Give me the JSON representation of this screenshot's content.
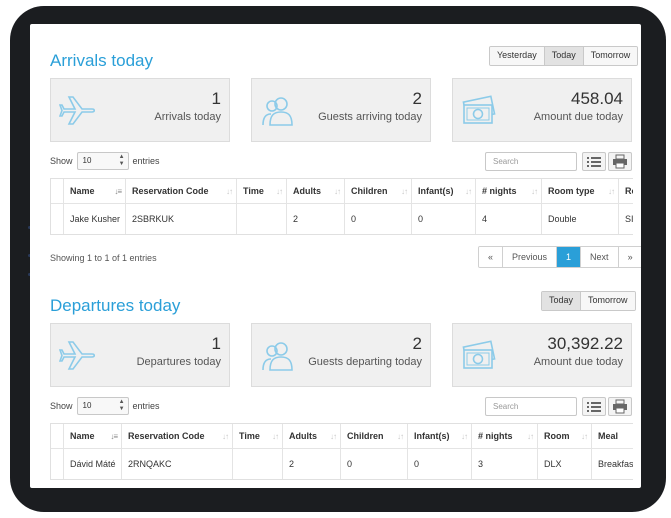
{
  "arrivals": {
    "title": "Arrivals today",
    "day_buttons": [
      "Yesterday",
      "Today",
      "Tomorrow"
    ],
    "stats": [
      {
        "value": "1",
        "label": "Arrivals today",
        "icon": "airplane-icon"
      },
      {
        "value": "2",
        "label": "Guests arriving today",
        "icon": "guests-icon"
      },
      {
        "value": "458.04",
        "label": "Amount due today",
        "icon": "money-icon"
      }
    ],
    "show_label": "Show",
    "entries_value": "10",
    "entries_label": "entries",
    "search_placeholder": "Search",
    "columns": [
      "Name",
      "Reservation Code",
      "Time",
      "Adults",
      "Children",
      "Infant(s)",
      "# nights",
      "Room type",
      "Ro"
    ],
    "rows": [
      [
        "Jake Kusher",
        "2SBRKUK",
        "",
        "2",
        "0",
        "0",
        "4",
        "Double",
        "SI"
      ]
    ],
    "info": "Showing 1 to 1 of 1 entries",
    "pager": [
      "«",
      "Previous",
      "1",
      "Next",
      "»"
    ]
  },
  "departures": {
    "title": "Departures today",
    "day_buttons": [
      "Today",
      "Tomorrow"
    ],
    "stats": [
      {
        "value": "1",
        "label": "Departures today",
        "icon": "airplane-icon"
      },
      {
        "value": "2",
        "label": "Guests departing today",
        "icon": "guests-icon"
      },
      {
        "value": "30,392.22",
        "label": "Amount due today",
        "icon": "money-icon"
      }
    ],
    "show_label": "Show",
    "entries_value": "10",
    "entries_label": "entries",
    "search_placeholder": "Search",
    "columns": [
      "Name",
      "Reservation Code",
      "Time",
      "Adults",
      "Children",
      "Infant(s)",
      "# nights",
      "Room",
      "Meal"
    ],
    "rows": [
      [
        "Dávid Máté",
        "2RNQAKC",
        "",
        "2",
        "0",
        "0",
        "3",
        "DLX",
        "Breakfas"
      ]
    ]
  },
  "colors": {
    "accent": "#2a9fd8",
    "icon": "#8ccbe9"
  }
}
